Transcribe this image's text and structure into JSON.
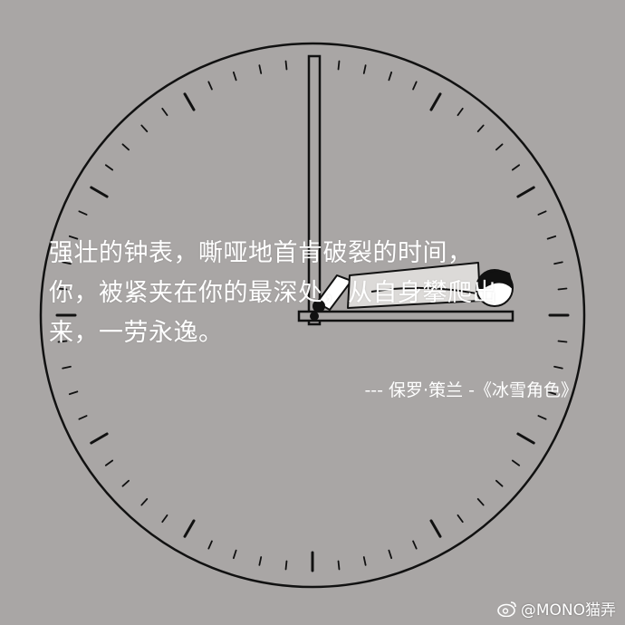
{
  "colors": {
    "background": "#a9a6a5",
    "ink": "#111111",
    "text": "#ffffff"
  },
  "quote": {
    "lines": [
      "强壮的钟表，嘶哑地首肯破裂的时间，",
      "你，被紧夹在你的最深处，从自身攀爬出",
      "来，一劳永逸。"
    ],
    "attribution": "--- 保罗·策兰 -《冰雪角色》"
  },
  "watermark": {
    "icon": "weibo-icon",
    "text": "@MONO猫弄"
  }
}
